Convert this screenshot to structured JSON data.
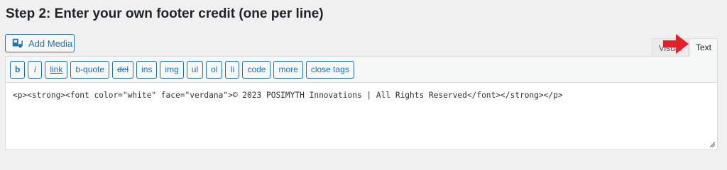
{
  "heading": "Step 2: Enter your own footer credit (one per line)",
  "add_media": {
    "label": "Add Media",
    "icon": "media-icon"
  },
  "tabs": {
    "visual": "Visual",
    "text": "Text"
  },
  "toolbar": {
    "buttons": [
      "b",
      "i",
      "link",
      "b-quote",
      "del",
      "ins",
      "img",
      "ul",
      "ol",
      "li",
      "code",
      "more",
      "close tags"
    ]
  },
  "editor": {
    "content": "<p><strong><font color=\"white\" face=\"verdana\">© 2023 POSIMYTH Innovations | All Rights Reserved</font></strong></p>"
  },
  "colors": {
    "accent": "#2271b1",
    "arrow": "#e3202a"
  }
}
